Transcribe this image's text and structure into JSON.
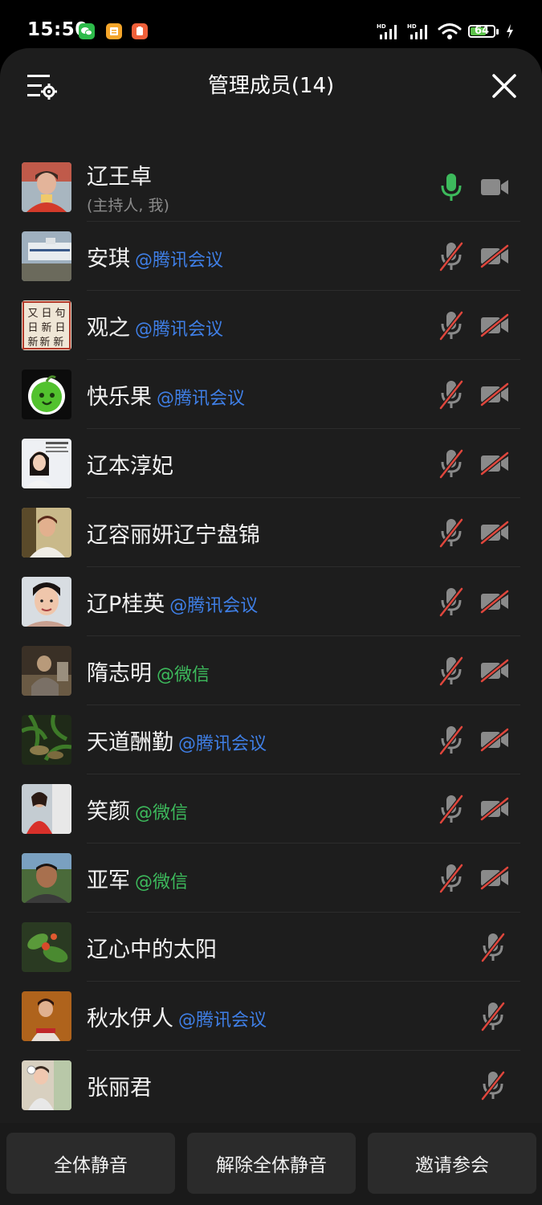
{
  "status_bar": {
    "time": "15:50",
    "battery": "64",
    "icons": [
      "wechat-icon",
      "notes-icon",
      "app-icon",
      "hd-signal-icon",
      "hd-signal-icon",
      "wifi-icon",
      "battery-icon",
      "charging-icon"
    ]
  },
  "header": {
    "title": "管理成员(14)",
    "left_icon": "member-settings-icon",
    "right_icon": "close-icon"
  },
  "colors": {
    "background": "#1d1d1d",
    "tag_tencent": "#3f7fe6",
    "tag_wechat": "#3dba5c",
    "mic_active": "#3dba5c",
    "muted_slash": "#e0463c"
  },
  "members": [
    {
      "name": "辽王卓",
      "tag": "",
      "sub": "(主持人, 我)",
      "mic": "on",
      "cam": "off-neutral"
    },
    {
      "name": "安琪",
      "tag": "@腾讯会议",
      "tag_type": "tencent",
      "mic": "muted",
      "cam": "muted"
    },
    {
      "name": "观之",
      "tag": "@腾讯会议",
      "tag_type": "tencent",
      "mic": "muted",
      "cam": "muted"
    },
    {
      "name": "快乐果",
      "tag": "@腾讯会议",
      "tag_type": "tencent",
      "mic": "muted",
      "cam": "muted"
    },
    {
      "name": "辽本淳妃",
      "tag": "",
      "mic": "muted",
      "cam": "muted"
    },
    {
      "name": "辽容丽妍辽宁盘锦",
      "tag": "",
      "mic": "muted",
      "cam": "muted"
    },
    {
      "name": "辽P桂英",
      "tag": "@腾讯会议",
      "tag_type": "tencent",
      "mic": "muted",
      "cam": "muted"
    },
    {
      "name": "隋志明",
      "tag": "@微信",
      "tag_type": "wechat",
      "mic": "muted",
      "cam": "muted"
    },
    {
      "name": "天道酬勤",
      "tag": "@腾讯会议",
      "tag_type": "tencent",
      "mic": "muted",
      "cam": "muted"
    },
    {
      "name": "笑颜",
      "tag": "@微信",
      "tag_type": "wechat",
      "mic": "muted",
      "cam": "muted"
    },
    {
      "name": "亚军",
      "tag": "@微信",
      "tag_type": "wechat",
      "mic": "muted",
      "cam": "muted"
    },
    {
      "name": "辽心中的太阳",
      "tag": "",
      "mic": "muted",
      "cam": "none"
    },
    {
      "name": "秋水伊人",
      "tag": "@腾讯会议",
      "tag_type": "tencent",
      "mic": "muted",
      "cam": "none"
    },
    {
      "name": "张丽君",
      "tag": "",
      "mic": "muted",
      "cam": "none"
    }
  ],
  "avatar_art": {
    "2": "句日日新 又日新"
  },
  "actions": {
    "mute_all": "全体静音",
    "unmute_all": "解除全体静音",
    "invite": "邀请参会"
  }
}
